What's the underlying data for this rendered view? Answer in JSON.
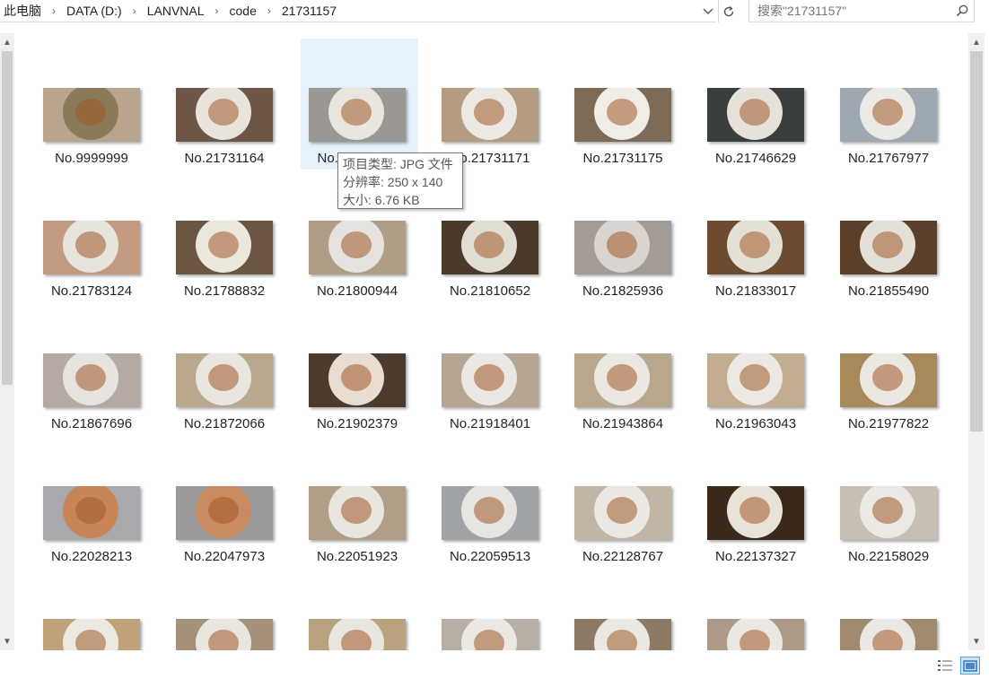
{
  "breadcrumb": [
    "此电脑",
    "DATA (D:)",
    "LANVNAL",
    "code",
    "21731157"
  ],
  "search": {
    "placeholder": "搜索\"21731157\""
  },
  "tooltip": {
    "line1": "项目类型: JPG 文件",
    "line2": "分辨率: 250 x 140",
    "line3": "大小: 6.76 KB"
  },
  "files": [
    {
      "name": "No.9999999",
      "bg": "#b9a58f",
      "plate": "#8a7a5a"
    },
    {
      "name": "No.21731164",
      "bg": "#6e5646",
      "plate": "#e8e4dc"
    },
    {
      "name": "No.21731157",
      "bg": "#9b9893",
      "plate": "#e9e6e0"
    },
    {
      "name": "No.21731171",
      "bg": "#b49c83",
      "plate": "#ece8e2"
    },
    {
      "name": "No.21731175",
      "bg": "#7d6b58",
      "plate": "#f0ece6"
    },
    {
      "name": "No.21746629",
      "bg": "#3a3f3d",
      "plate": "#e6e2da"
    },
    {
      "name": "No.21767977",
      "bg": "#9ea8b2",
      "plate": "#eceae6"
    },
    {
      "name": "No.21783124",
      "bg": "#c29a7f",
      "plate": "#e7e3dd"
    },
    {
      "name": "No.21788832",
      "bg": "#6a5642",
      "plate": "#ece7dd"
    },
    {
      "name": "No.21800944",
      "bg": "#b09d87",
      "plate": "#e6e2dd"
    },
    {
      "name": "No.21810652",
      "bg": "#4b3a2a",
      "plate": "#e2ddd3"
    },
    {
      "name": "No.21825936",
      "bg": "#a39b95",
      "plate": "#d9d4cf"
    },
    {
      "name": "No.21833017",
      "bg": "#6c4b30",
      "plate": "#e5e0d6"
    },
    {
      "name": "No.21855490",
      "bg": "#5a3f2a",
      "plate": "#e4e0d8"
    },
    {
      "name": "No.21867696",
      "bg": "#b4aaa3",
      "plate": "#e7e3de"
    },
    {
      "name": "No.21872066",
      "bg": "#b9a88e",
      "plate": "#e9e5df"
    },
    {
      "name": "No.21902379",
      "bg": "#4c3a2c",
      "plate": "#e8ddd0"
    },
    {
      "name": "No.21918401",
      "bg": "#b6a593",
      "plate": "#ebe7e2"
    },
    {
      "name": "No.21943864",
      "bg": "#b8a68d",
      "plate": "#ebe7e1"
    },
    {
      "name": "No.21963043",
      "bg": "#c2ad92",
      "plate": "#ece8e3"
    },
    {
      "name": "No.21977822",
      "bg": "#a8895c",
      "plate": "#ebe7e1"
    },
    {
      "name": "No.22028213",
      "bg": "#a7a9ac",
      "plate": "#c9855a"
    },
    {
      "name": "No.22047973",
      "bg": "#9a9a9a",
      "plate": "#c98b62"
    },
    {
      "name": "No.22051923",
      "bg": "#b09e88",
      "plate": "#e9e5df"
    },
    {
      "name": "No.22059513",
      "bg": "#9fa3a6",
      "plate": "#e7e5e2"
    },
    {
      "name": "No.22128767",
      "bg": "#c1b6a6",
      "plate": "#ebe8e3"
    },
    {
      "name": "No.22137327",
      "bg": "#3b2a1c",
      "plate": "#e9e2d7"
    },
    {
      "name": "No.22158029",
      "bg": "#c7bfb4",
      "plate": "#ece9e4"
    },
    {
      "name": "",
      "bg": "#c0a27a",
      "plate": "#ece8e2"
    },
    {
      "name": "",
      "bg": "#a5907a",
      "plate": "#e9e5df"
    },
    {
      "name": "",
      "bg": "#b9a27e",
      "plate": "#e9e5df"
    },
    {
      "name": "",
      "bg": "#b7aea5",
      "plate": "#ebe8e4"
    },
    {
      "name": "",
      "bg": "#8d7a66",
      "plate": "#ebe8e3"
    },
    {
      "name": "",
      "bg": "#ac9987",
      "plate": "#ebe7e2"
    },
    {
      "name": "",
      "bg": "#a08b6e",
      "plate": "#ebe7e2"
    }
  ]
}
